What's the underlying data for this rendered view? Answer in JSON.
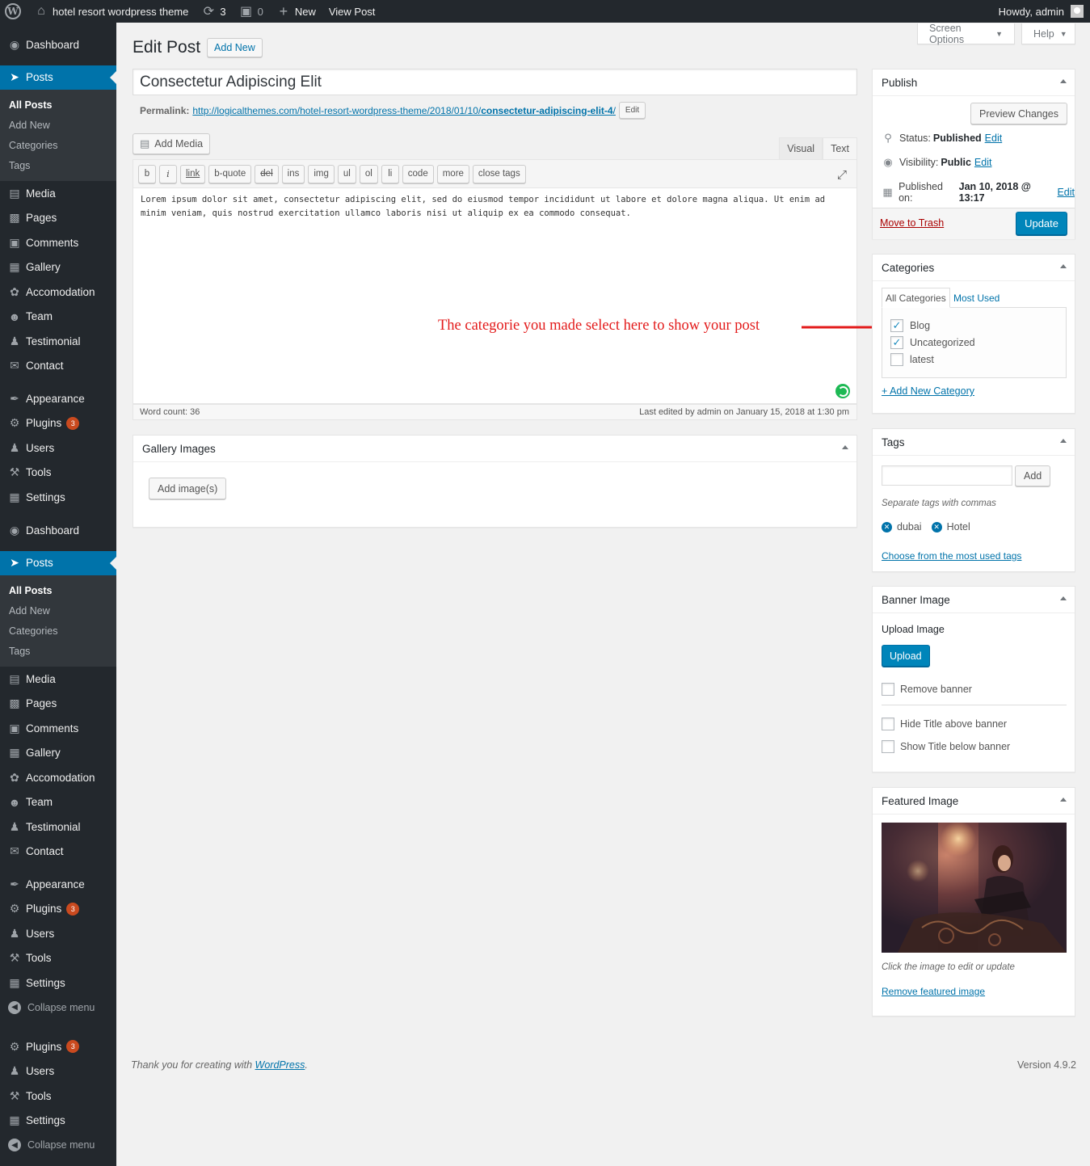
{
  "adminbar": {
    "site_name": "hotel resort wordpress theme",
    "updates_count": "3",
    "comments_count": "0",
    "new_label": "New",
    "view_post_label": "View Post",
    "howdy": "Howdy, admin"
  },
  "sidebar": {
    "dashboard": "Dashboard",
    "posts": "Posts",
    "posts_sub": [
      "All Posts",
      "Add New",
      "Categories",
      "Tags"
    ],
    "media": "Media",
    "pages": "Pages",
    "comments": "Comments",
    "gallery": "Gallery",
    "accomodation": "Accomodation",
    "team": "Team",
    "testimonial": "Testimonial",
    "contact": "Contact",
    "appearance": "Appearance",
    "plugins": "Plugins",
    "plugins_badge": "3",
    "users": "Users",
    "tools": "Tools",
    "settings": "Settings",
    "collapse": "Collapse menu"
  },
  "screen_options": {
    "label": "Screen Options",
    "help": "Help"
  },
  "page": {
    "title": "Edit Post",
    "add_new": "Add New",
    "post_title": "Consectetur Adipiscing Elit",
    "permalink_label": "Permalink:",
    "permalink_base": "http://logicalthemes.com/hotel-resort-wordpress-theme/2018/01/10/",
    "permalink_slug": "consectetur-adipiscing-elit-4",
    "permalink_end": "/",
    "permalink_edit": "Edit"
  },
  "editor": {
    "add_media": "Add Media",
    "tab_visual": "Visual",
    "tab_text": "Text",
    "toolbar": [
      "b",
      "i",
      "link",
      "b-quote",
      "del",
      "ins",
      "img",
      "ul",
      "ol",
      "li",
      "code",
      "more",
      "close tags"
    ],
    "content": "Lorem ipsum dolor sit amet, consectetur adipiscing elit, sed do eiusmod tempor incididunt ut labore et dolore magna aliqua. Ut enim ad minim veniam, quis nostrud exercitation ullamco laboris nisi ut aliquip ex ea commodo consequat.",
    "word_count": "Word count: 36",
    "last_edited": "Last edited by admin on January 15, 2018 at 1:30 pm"
  },
  "annotation": "The categorie you made select here to show your post",
  "gallery_box": {
    "title": "Gallery Images",
    "add_images": "Add image(s)"
  },
  "publish": {
    "title": "Publish",
    "preview": "Preview Changes",
    "status_label": "Status:",
    "status_value": "Published",
    "visibility_label": "Visibility:",
    "visibility_value": "Public",
    "published_label": "Published on:",
    "published_value": "Jan 10, 2018 @ 13:17",
    "edit": "Edit",
    "trash": "Move to Trash",
    "update": "Update"
  },
  "categories": {
    "title": "Categories",
    "tab_all": "All Categories",
    "tab_most_used": "Most Used",
    "items": [
      {
        "label": "Blog",
        "checked": true
      },
      {
        "label": "Uncategorized",
        "checked": true
      },
      {
        "label": "latest",
        "checked": false
      }
    ],
    "add_new": "+ Add New Category"
  },
  "tags": {
    "title": "Tags",
    "add": "Add",
    "hint": "Separate tags with commas",
    "items": [
      "dubai",
      "Hotel"
    ],
    "choose": "Choose from the most used tags"
  },
  "banner": {
    "title": "Banner Image",
    "upload_label": "Upload Image",
    "upload_button": "Upload",
    "remove": "Remove banner",
    "hide_title": "Hide Title above banner",
    "show_title": "Show Title below banner"
  },
  "featured": {
    "title": "Featured Image",
    "hint": "Click the image to edit or update",
    "remove": "Remove featured image"
  },
  "footer": {
    "thanks_prefix": "Thank you for creating with ",
    "wordpress": "WordPress",
    "thanks_suffix": ".",
    "version": "Version 4.9.2"
  },
  "colors": {
    "adminbar": "#23282d",
    "sidebar": "#23282d",
    "accent": "#0073aa",
    "primary_button": "#0085ba",
    "annotation": "#e31b1b",
    "trash": "#a00"
  }
}
